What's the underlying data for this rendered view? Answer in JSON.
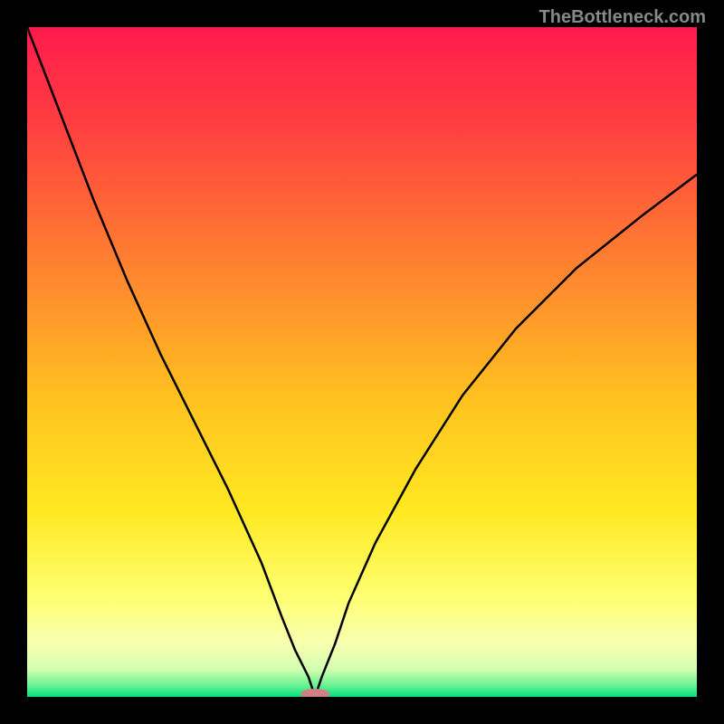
{
  "watermark": "TheBottleneck.com",
  "chart_data": {
    "type": "line",
    "title": "",
    "xlabel": "",
    "ylabel": "",
    "xlim": [
      0,
      100
    ],
    "ylim": [
      0,
      100
    ],
    "note": "implicit axes (no tick labels in original). V-shaped curve plotted over vertical rainbow gradient background with minimum around x=43",
    "series": [
      {
        "name": "bottleneck-curve",
        "x": [
          0,
          5,
          10,
          15,
          20,
          25,
          30,
          35,
          38,
          40,
          42,
          43,
          44,
          46,
          48,
          52,
          58,
          65,
          73,
          82,
          92,
          100
        ],
        "y": [
          100,
          87,
          74,
          62,
          51,
          41,
          31,
          20,
          12,
          7,
          3,
          0,
          3,
          8,
          14,
          23,
          34,
          45,
          55,
          64,
          72,
          78
        ]
      }
    ],
    "marker": {
      "name": "min-marker",
      "x": 43,
      "y": 0,
      "color": "#d08080"
    },
    "gradient_stops": [
      {
        "offset": 0.0,
        "color": "#ff1a4d"
      },
      {
        "offset": 0.15,
        "color": "#ff4040"
      },
      {
        "offset": 0.35,
        "color": "#ff8030"
      },
      {
        "offset": 0.55,
        "color": "#ffc020"
      },
      {
        "offset": 0.72,
        "color": "#ffe820"
      },
      {
        "offset": 0.85,
        "color": "#feff70"
      },
      {
        "offset": 0.92,
        "color": "#f8ffb0"
      },
      {
        "offset": 0.96,
        "color": "#d0ffb0"
      },
      {
        "offset": 0.985,
        "color": "#60f090"
      },
      {
        "offset": 1.0,
        "color": "#00e080"
      }
    ]
  }
}
